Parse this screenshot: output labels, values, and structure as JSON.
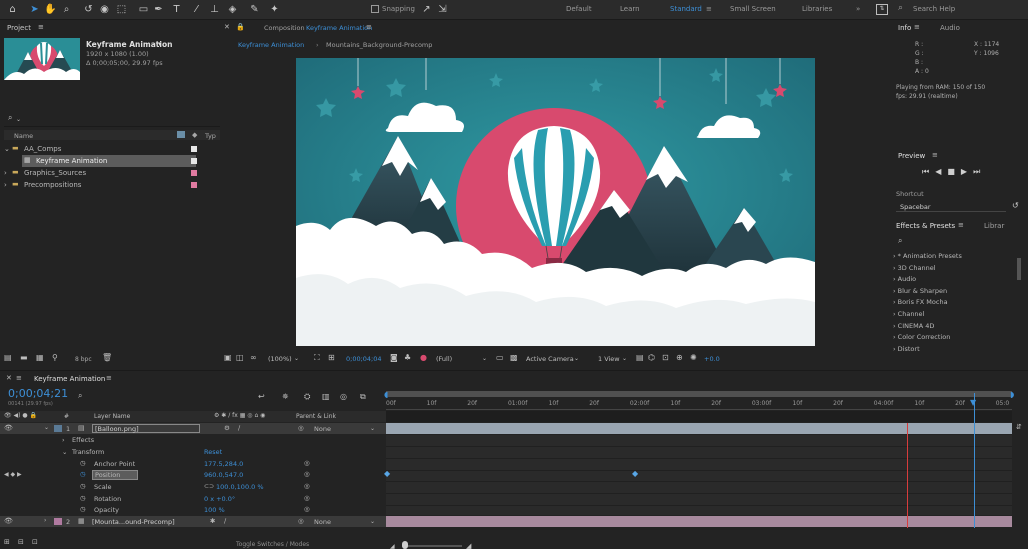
{
  "toolbar": {
    "snapping_label": "Snapping",
    "workspaces": [
      "Default",
      "Learn",
      "Standard",
      "Small Screen",
      "Libraries"
    ],
    "active_workspace": "Standard",
    "search_help": "Search Help"
  },
  "project": {
    "tab": "Project",
    "comp_name": "Keyframe Animation",
    "comp_res": "1920 x 1080 (1.00)",
    "comp_dur": "Δ 0;00;05;00, 29.97 fps",
    "columns": {
      "name": "Name",
      "type": "Typ"
    },
    "items": [
      {
        "label": "AA_Comps",
        "indent": 0,
        "color": "white"
      },
      {
        "label": "Keyframe Animation",
        "indent": 1,
        "color": "white",
        "selected": true
      },
      {
        "label": "Graphics_Sources",
        "indent": 0,
        "color": "pink"
      },
      {
        "label": "Precompositions",
        "indent": 0,
        "color": "pink"
      }
    ],
    "bpc": "8 bpc"
  },
  "composition": {
    "tab": "Composition Keyframe Animation",
    "tab_prefix": "Composition",
    "tab_name": "Keyframe Animation",
    "breadcrumbs": [
      "Keyframe Animation",
      "Mountains_Background-Precomp"
    ],
    "zoom": "(100%)",
    "timecode": "0;00;04;04",
    "resolution": "(Full)",
    "camera": "Active Camera",
    "view": "1 View",
    "exposure": "+0.0"
  },
  "info": {
    "tab": "Info",
    "tab2": "Audio",
    "r": "R :",
    "g": "G :",
    "b": "B :",
    "a": "A : 0",
    "x": "X : 1174",
    "y": "Y : 1096",
    "playing": "Playing from RAM: 150 of 150",
    "fps": "fps: 29.91 (realtime)"
  },
  "preview": {
    "tab": "Preview",
    "shortcut_label": "Shortcut",
    "shortcut_value": "Spacebar"
  },
  "effects": {
    "tab": "Effects & Presets",
    "tab2": "Librar",
    "items": [
      "* Animation Presets",
      "3D Channel",
      "Audio",
      "Blur & Sharpen",
      "Boris FX Mocha",
      "Channel",
      "CINEMA 4D",
      "Color Correction",
      "Distort"
    ]
  },
  "timeline": {
    "tab": "Keyframe Animation",
    "timecode": "0;00;04;21",
    "fps_sub": "00141 (29.97 fps)",
    "col_layer": "Layer Name",
    "col_parent": "Parent & Link",
    "layers": [
      {
        "num": "1",
        "name": "[Balloon.png]",
        "parent": "None"
      },
      {
        "num": "2",
        "name": "[Mounta...ound-Precomp]",
        "parent": "None"
      }
    ],
    "props": {
      "effects": "Effects",
      "transform": "Transform",
      "reset": "Reset",
      "anchor": "Anchor Point",
      "anchor_val": "177.5,284.0",
      "position": "Position",
      "position_val": "960.0,547.0",
      "scale": "Scale",
      "scale_val": "100.0,100.0 %",
      "rotation": "Rotation",
      "rotation_val": "0 x +0.0°",
      "opacity": "Opacity",
      "opacity_val": "100 %"
    },
    "ruler": [
      "00f",
      "10f",
      "20f",
      "01:00f",
      "10f",
      "20f",
      "02:00f",
      "10f",
      "20f",
      "03:00f",
      "10f",
      "20f",
      "04:00f",
      "10f",
      "20f",
      "05:0"
    ],
    "footer": "Toggle Switches / Modes"
  },
  "colors": {
    "accent": "#3d8fd6",
    "sky": "#2a8e96",
    "sun": "#d84a6e",
    "playhead": "#d83c3c"
  }
}
